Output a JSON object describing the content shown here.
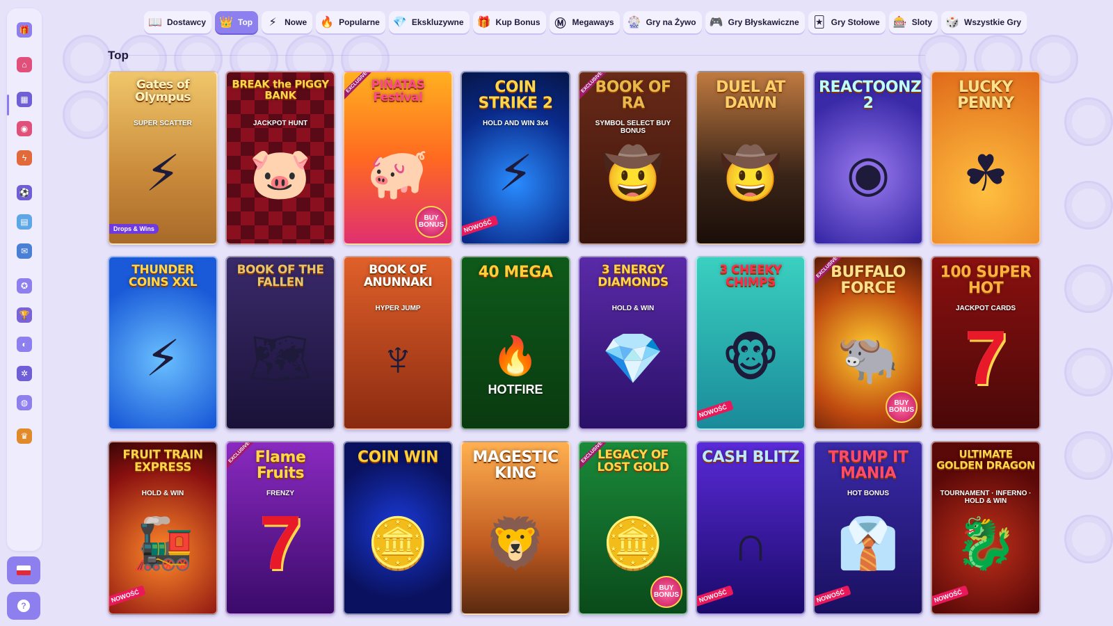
{
  "tabs": [
    {
      "label": "Dostawcy",
      "icon": "book-icon",
      "active": false
    },
    {
      "label": "Top",
      "icon": "crown-icon",
      "active": true
    },
    {
      "label": "Nowe",
      "icon": "lightning-icon",
      "active": false
    },
    {
      "label": "Popularne",
      "icon": "flame-icon",
      "active": false
    },
    {
      "label": "Ekskluzywne",
      "icon": "diamond-icon",
      "active": false
    },
    {
      "label": "Kup Bonus",
      "icon": "gift-icon",
      "active": false
    },
    {
      "label": "Megaways",
      "icon": "m-icon",
      "active": false
    },
    {
      "label": "Gry na Żywo",
      "icon": "roulette-icon",
      "active": false
    },
    {
      "label": "Gry Błyskawiczne",
      "icon": "gamepad-icon",
      "active": false
    },
    {
      "label": "Gry Stołowe",
      "icon": "cards-icon",
      "active": false
    },
    {
      "label": "Sloty",
      "icon": "slot-machine-icon",
      "active": false
    },
    {
      "label": "Wszystkie Gry",
      "icon": "dice-icon",
      "active": false
    }
  ],
  "section": {
    "title": "Top"
  },
  "badges": {
    "new": "NOWOŚĆ",
    "exclusive": "EXCLUSIVE",
    "buy_bonus": "BUY BONUS",
    "drops": "Drops & Wins"
  },
  "sidebar": {
    "icons": [
      "gift-icon",
      "home-icon",
      "slots-icon",
      "live-icon",
      "lightning-icon",
      "sports-icon",
      "cards-icon",
      "promo-icon",
      "rewards-icon",
      "trophy-icon",
      "shop-icon",
      "roulette-icon",
      "chat-icon",
      "vip-crown-icon"
    ],
    "language": "pl-flag-icon",
    "help": "?"
  },
  "games": [
    {
      "title": "Gates of Olympus",
      "sub": "SUPER SCATTER",
      "theme": "olympus",
      "badge": "drops"
    },
    {
      "title": "BREAK the PIGGY BANK",
      "sub": "JACKPOT HUNT",
      "theme": "piggy",
      "badge": ""
    },
    {
      "title": "PIÑATAS Festival",
      "sub": "",
      "theme": "pinatas",
      "badge": "exclusive-buy"
    },
    {
      "title": "COIN STRIKE 2",
      "sub": "HOLD AND WIN 3x4",
      "theme": "coinstrike",
      "badge": "new"
    },
    {
      "title": "BOOK OF RA",
      "sub": "SYMBOL SELECT BUY BONUS",
      "theme": "bookofra",
      "badge": "exclusive"
    },
    {
      "title": "DUEL AT DAWN",
      "sub": "",
      "theme": "duel",
      "badge": ""
    },
    {
      "title": "REACTOONZ 2",
      "sub": "",
      "theme": "reactoonz",
      "badge": ""
    },
    {
      "title": "LUCKY PENNY",
      "sub": "",
      "theme": "lucky",
      "badge": ""
    },
    {
      "title": "THUNDER COINS XXL",
      "sub": "",
      "theme": "thunder",
      "badge": ""
    },
    {
      "title": "BOOK OF THE FALLEN",
      "sub": "",
      "theme": "fallen",
      "badge": ""
    },
    {
      "title": "BOOK OF ANUNNAKI",
      "sub": "HYPER JUMP",
      "theme": "anunnaki",
      "badge": ""
    },
    {
      "title": "40 MEGA",
      "sub": "HOTFIRE",
      "theme": "mega40",
      "badge": ""
    },
    {
      "title": "3 ENERGY DIAMONDS",
      "sub": "HOLD & WIN",
      "theme": "diamonds",
      "badge": ""
    },
    {
      "title": "3 CHEEKY CHIMPS",
      "sub": "",
      "theme": "chimps",
      "badge": "new"
    },
    {
      "title": "BUFFALO FORCE",
      "sub": "",
      "theme": "buffalo",
      "badge": "exclusive-buy"
    },
    {
      "title": "100 SUPER HOT",
      "sub": "JACKPOT CARDS",
      "theme": "superhot",
      "badge": ""
    },
    {
      "title": "FRUIT TRAIN EXPRESS",
      "sub": "HOLD & WIN",
      "theme": "train",
      "badge": "new"
    },
    {
      "title": "Flame Fruits",
      "sub": "FRENZY",
      "theme": "flamefruits",
      "badge": "exclusive"
    },
    {
      "title": "COIN WIN",
      "sub": "",
      "theme": "coinwin",
      "badge": ""
    },
    {
      "title": "MAGESTIC KING",
      "sub": "",
      "theme": "king",
      "badge": ""
    },
    {
      "title": "LEGACY OF LOST GOLD",
      "sub": "",
      "theme": "legacy",
      "badge": "exclusive-buy"
    },
    {
      "title": "CASH BLITZ",
      "sub": "",
      "theme": "cashblitz",
      "badge": "new"
    },
    {
      "title": "TRUMP IT MANIA",
      "sub": "HOT BONUS",
      "theme": "trump",
      "badge": "new"
    },
    {
      "title": "ULTIMATE GOLDEN DRAGON",
      "sub": "TOURNAMENT · INFERNO · HOLD & WIN",
      "theme": "dragon",
      "badge": "new"
    }
  ]
}
